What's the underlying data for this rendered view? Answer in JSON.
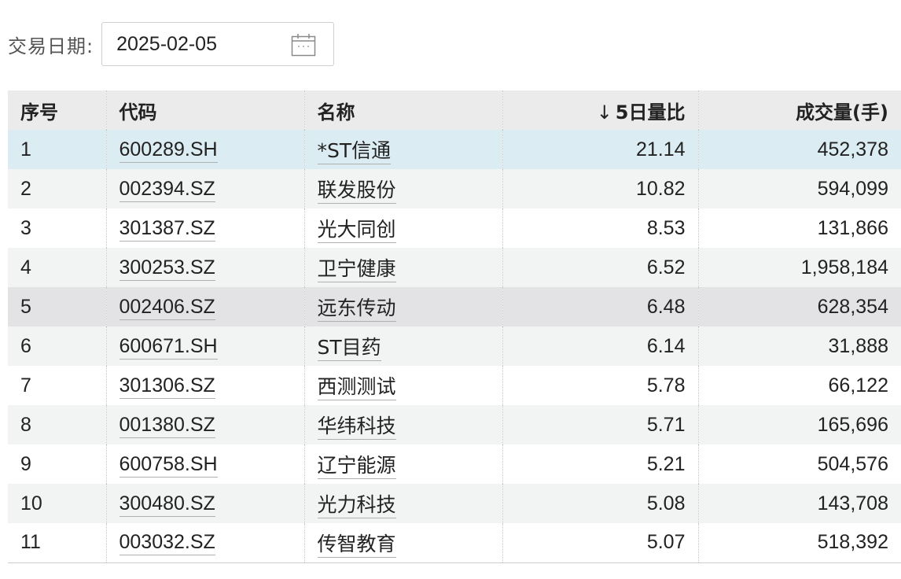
{
  "filter": {
    "date_label": "交易日期:",
    "date_value": "2025-02-05",
    "calendar_icon": "calendar-icon"
  },
  "table": {
    "headers": {
      "index": "序号",
      "code": "代码",
      "name": "名称",
      "sort_arrow": "↓",
      "volume_ratio": "5日量比",
      "volume": "成交量(手)"
    },
    "sort": {
      "column": "volume_ratio",
      "direction": "descending"
    },
    "selected_row": 1,
    "hovered_row": 5,
    "rows": [
      {
        "index": "1",
        "code": "600289.SH",
        "name": "*ST信通",
        "ratio": "21.14",
        "volume": "452,378"
      },
      {
        "index": "2",
        "code": "002394.SZ",
        "name": "联发股份",
        "ratio": "10.82",
        "volume": "594,099"
      },
      {
        "index": "3",
        "code": "301387.SZ",
        "name": "光大同创",
        "ratio": "8.53",
        "volume": "131,866"
      },
      {
        "index": "4",
        "code": "300253.SZ",
        "name": "卫宁健康",
        "ratio": "6.52",
        "volume": "1,958,184"
      },
      {
        "index": "5",
        "code": "002406.SZ",
        "name": "远东传动",
        "ratio": "6.48",
        "volume": "628,354"
      },
      {
        "index": "6",
        "code": "600671.SH",
        "name": "ST目药",
        "ratio": "6.14",
        "volume": "31,888"
      },
      {
        "index": "7",
        "code": "301306.SZ",
        "name": "西测测试",
        "ratio": "5.78",
        "volume": "66,122"
      },
      {
        "index": "8",
        "code": "001380.SZ",
        "name": "华纬科技",
        "ratio": "5.71",
        "volume": "165,696"
      },
      {
        "index": "9",
        "code": "600758.SH",
        "name": "辽宁能源",
        "ratio": "5.21",
        "volume": "504,576"
      },
      {
        "index": "10",
        "code": "300480.SZ",
        "name": "光力科技",
        "ratio": "5.08",
        "volume": "143,708"
      },
      {
        "index": "11",
        "code": "003032.SZ",
        "name": "传智教育",
        "ratio": "5.07",
        "volume": "518,392"
      }
    ]
  }
}
